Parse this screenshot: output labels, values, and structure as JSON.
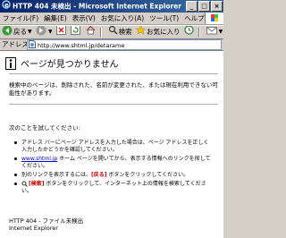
{
  "window": {
    "title": "HTTP 404 未検出 - Microsoft Internet Explorer",
    "buttons": [
      "_",
      "□",
      "×"
    ]
  },
  "menu": {
    "items": [
      "ファイル(F)",
      "編集(E)",
      "表示(V)",
      "お気に入り(A)",
      "ツール(T)",
      "ヘルプ(H)"
    ]
  },
  "toolbar": {
    "back_label": "戻る",
    "search_label": "検索",
    "favorites_label": "お気に入り"
  },
  "address": {
    "label": "アドレス(D)",
    "url": "http://www.shtml.jp/detarame"
  },
  "page": {
    "heading": "ページが見つかりません",
    "description": "検索中のページは、削除された、名前が変更された、または現在利用できない可能性があります。",
    "try_heading": "次のことを試してください:",
    "items": [
      {
        "text": "アドレス バーにページ アドレスを入力した場合は、ページ アドレスを正しく入力したかどうかを確認してください。"
      },
      {
        "link": "www.shtml.jp",
        "text": " ホーム ページを開いてから、表示する情報へのリンクを探してください。"
      },
      {
        "pre": "別のリンクを表示するには、",
        "btn": "[戻る]",
        "post": " ボタンをクリックしてください。"
      },
      {
        "btn": "[検索]",
        "post": " ボタンをクリックして、インターネット上の情報を検索してください。"
      }
    ],
    "footer_line1": "HTTP 404 - ファイル未検出",
    "footer_line2": "Internet Explorer"
  }
}
